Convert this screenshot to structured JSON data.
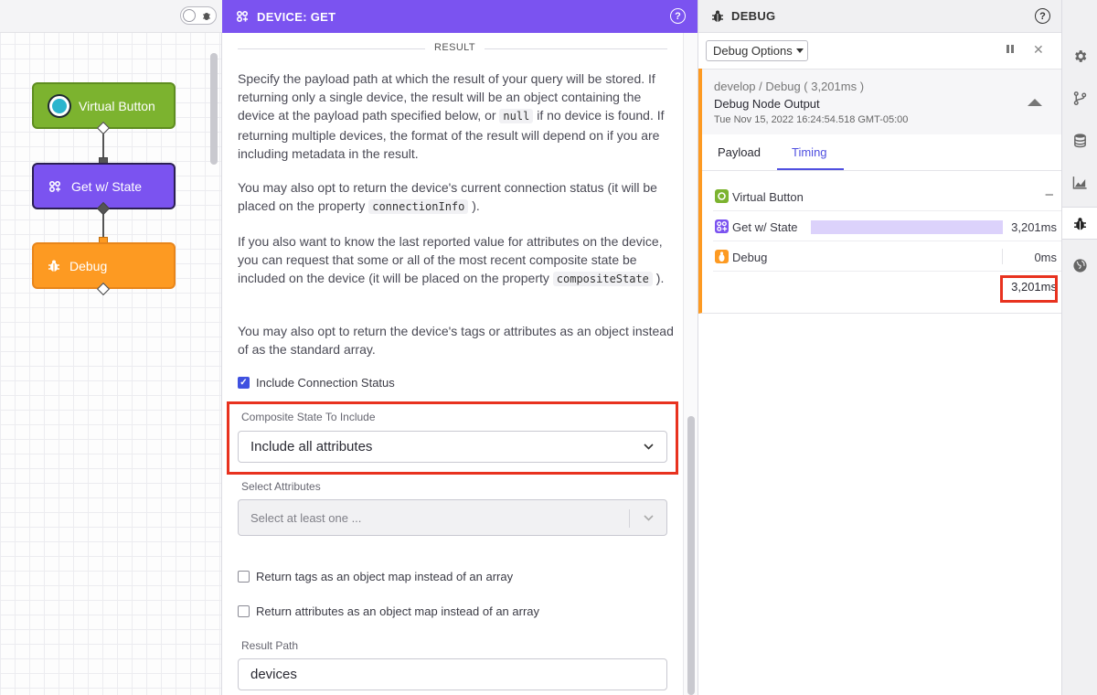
{
  "canvas": {
    "nodes": {
      "virtual_button": "Virtual Button",
      "get_state": "Get w/ State",
      "debug": "Debug"
    }
  },
  "editor": {
    "header_title": "DEVICE: GET",
    "section_label": "RESULT",
    "paragraphs": {
      "p1_a": "Specify the payload path at which the result of your query will be stored. If returning only a single device, the result will be an object containing the device at the payload path specified below, or ",
      "p1_code": "null",
      "p1_b": " if no device is found. If returning multiple devices, the format of the result will depend on if you are including metadata in the result.",
      "p2_a": "You may also opt to return the device's current connection status (it will be placed on the property ",
      "p2_code": "connectionInfo",
      "p2_b": " ).",
      "p3_a": "If you also want to know the last reported value for attributes on the device, you can request that some or all of the most recent composite state be included on the device (it will be placed on the property ",
      "p3_code": "compositeState",
      "p3_b": " ).",
      "p4": "You may also opt to return the device's tags or attributes as an object instead of as the standard array."
    },
    "include_connection_status": "Include Connection Status",
    "composite_state_label": "Composite State To Include",
    "composite_state_value": "Include all attributes",
    "select_attributes_label": "Select Attributes",
    "select_attributes_placeholder": "Select at least one ...",
    "return_tags": "Return tags as an object map instead of an array",
    "return_attributes": "Return attributes as an object map instead of an array",
    "result_path_label": "Result Path",
    "result_path_value": "devices"
  },
  "debug": {
    "header_title": "DEBUG",
    "options_label": "Debug Options",
    "message": {
      "path": "develop / Debug ( 3,201ms )",
      "title": "Debug Node Output",
      "timestamp": "Tue Nov 15, 2022 16:24:54.518 GMT-05:00"
    },
    "tabs": [
      "Payload",
      "Timing"
    ],
    "active_tab": "Timing",
    "timing": {
      "rows": [
        {
          "name": "Virtual Button",
          "value": "–",
          "color": "#7cb32f",
          "fraction": 0
        },
        {
          "name": "Get w/ State",
          "value": "3,201ms",
          "color": "#7b53f0",
          "fraction": 1.0
        },
        {
          "name": "Debug",
          "value": "0ms",
          "color": "#fd9a22",
          "fraction": 0
        }
      ],
      "total": "3,201ms"
    }
  },
  "rail": {
    "icons": [
      "gear-icon",
      "branch-icon",
      "database-icon",
      "chart-icon",
      "bug-icon",
      "globe-icon"
    ],
    "active": "bug-icon"
  }
}
